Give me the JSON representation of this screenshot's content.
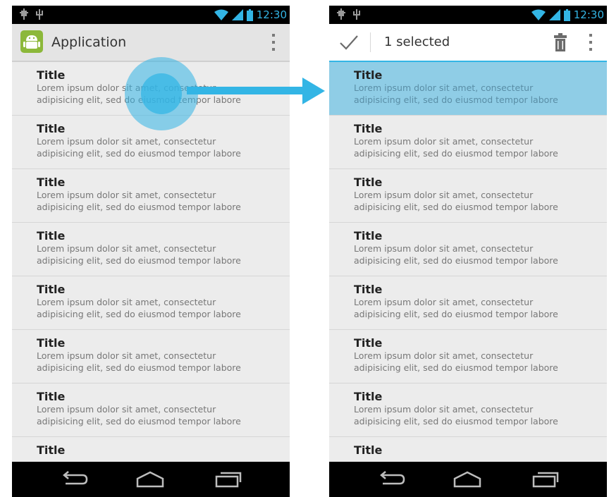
{
  "status_bar": {
    "time": "12:30"
  },
  "before": {
    "app_title": "Application",
    "list_items": [
      {
        "title": "Title",
        "line1": "Lorem ipsum dolor sit amet, consectetur",
        "line2": "adipisicing elit, sed do eiusmod tempor labore"
      },
      {
        "title": "Title",
        "line1": "Lorem ipsum dolor sit amet, consectetur",
        "line2": "adipisicing elit, sed do eiusmod tempor labore"
      },
      {
        "title": "Title",
        "line1": "Lorem ipsum dolor sit amet, consectetur",
        "line2": "adipisicing elit, sed do eiusmod tempor labore"
      },
      {
        "title": "Title",
        "line1": "Lorem ipsum dolor sit amet, consectetur",
        "line2": "adipisicing elit, sed do eiusmod tempor labore"
      },
      {
        "title": "Title",
        "line1": "Lorem ipsum dolor sit amet, consectetur",
        "line2": "adipisicing elit, sed do eiusmod tempor labore"
      },
      {
        "title": "Title",
        "line1": "Lorem ipsum dolor sit amet, consectetur",
        "line2": "adipisicing elit, sed do eiusmod tempor labore"
      },
      {
        "title": "Title",
        "line1": "Lorem ipsum dolor sit amet, consectetur",
        "line2": "adipisicing elit, sed do eiusmod tempor labore"
      },
      {
        "title": "Title"
      }
    ]
  },
  "after": {
    "selection_label": "1 selected",
    "list_items": [
      {
        "title": "Title",
        "line1": "Lorem ipsum dolor sit amet, consectetur",
        "line2": "adipisicing elit, sed do eiusmod tempor labore",
        "selected": true
      },
      {
        "title": "Title",
        "line1": "Lorem ipsum dolor sit amet, consectetur",
        "line2": "adipisicing elit, sed do eiusmod tempor labore"
      },
      {
        "title": "Title",
        "line1": "Lorem ipsum dolor sit amet, consectetur",
        "line2": "adipisicing elit, sed do eiusmod tempor labore"
      },
      {
        "title": "Title",
        "line1": "Lorem ipsum dolor sit amet, consectetur",
        "line2": "adipisicing elit, sed do eiusmod tempor labore"
      },
      {
        "title": "Title",
        "line1": "Lorem ipsum dolor sit amet, consectetur",
        "line2": "adipisicing elit, sed do eiusmod tempor labore"
      },
      {
        "title": "Title",
        "line1": "Lorem ipsum dolor sit amet, consectetur",
        "line2": "adipisicing elit, sed do eiusmod tempor labore"
      },
      {
        "title": "Title",
        "line1": "Lorem ipsum dolor sit amet, consectetur",
        "line2": "adipisicing elit, sed do eiusmod tempor labore"
      },
      {
        "title": "Title"
      }
    ]
  },
  "icons": {
    "status_left": [
      "usb-debug-icon",
      "usb-icon"
    ],
    "status_right": [
      "wifi-icon",
      "signal-icon",
      "battery-icon"
    ],
    "app": "android-app-icon",
    "overflow": "overflow-menu-icon",
    "done": "checkmark-icon",
    "delete": "trash-icon",
    "nav": [
      "back-icon",
      "home-icon",
      "recent-apps-icon"
    ]
  },
  "colors": {
    "accent": "#33b5e5",
    "selected_row": "#8fcde6",
    "list_background": "#ececec",
    "system_bar": "#000000"
  }
}
